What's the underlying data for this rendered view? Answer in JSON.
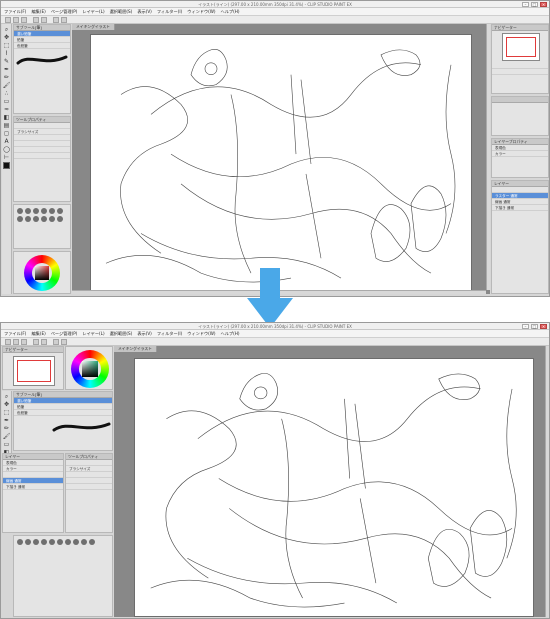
{
  "menu_items": [
    "ファイル(F)",
    "編集(E)",
    "ページ管理(P)",
    "レイヤー(L)",
    "選択範囲(S)",
    "表示(V)",
    "フィルター(I)",
    "ウィンドウ(W)",
    "ヘルプ(H)"
  ],
  "top_shot": {
    "title": "イラスト(ライン) (297.00 x 210.00mm 350dpi 31.4%) - CLIP STUDIO PAINT EX",
    "canvas_tab": "メイキングイラスト",
    "tool_property_label": "ツールプロパティ",
    "layer_panel_label": "レイヤー",
    "layer_rows": [
      "ラスター 通常",
      "線画 通常",
      "下描き 通常"
    ],
    "layer_property_label": "レイヤープロパティ",
    "expression_color_label": "表現色",
    "expression_color_value": "カラー",
    "brush_label": "ブラシサイズ"
  },
  "bottom_shot": {
    "title": "イラスト(ライン) (297.00 x 210.00mm 350dpi 31.4%) - CLIP STUDIO PAINT EX",
    "canvas_tab": "メイキングイラスト",
    "navigator_label": "ナビゲーター",
    "sub_tool_label": "サブツール[筆]",
    "tool_property_label": "ツールプロパティ",
    "layer_panel_label": "レイヤー",
    "layer_rows": [
      "線画 通常",
      "下描き 通常"
    ],
    "expression_color_label": "表現色",
    "expression_color_value": "カラー",
    "brush_label": "ブラシサイズ"
  },
  "colors": {
    "arrow": "#4aa8e8",
    "selection_blue": "#5a8fd8",
    "navigator_frame": "#e03a3a"
  }
}
